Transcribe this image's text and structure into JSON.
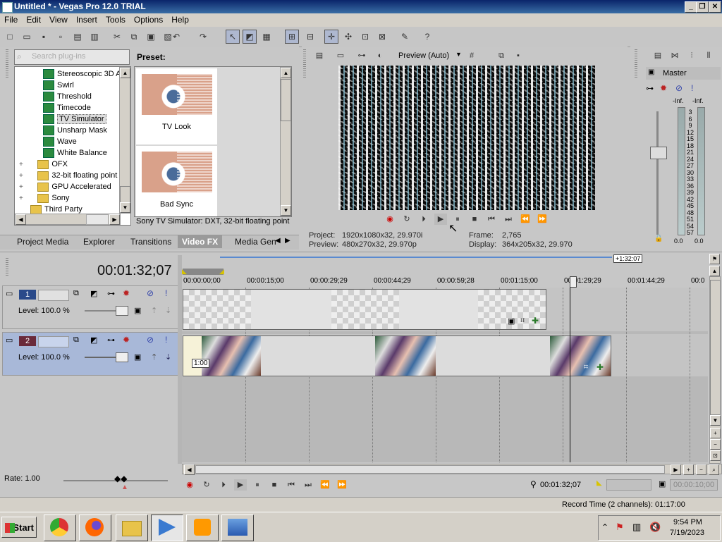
{
  "window": {
    "title": "Untitled * - Vegas Pro 12.0 TRIAL",
    "min": "_",
    "restore": "❐",
    "close": "✕"
  },
  "menu": [
    "File",
    "Edit",
    "View",
    "Insert",
    "Tools",
    "Options",
    "Help"
  ],
  "explorer": {
    "search_placeholder": "Search plug-ins",
    "items": [
      {
        "label": "Stereoscopic 3D A",
        "kind": "fx"
      },
      {
        "label": "Swirl",
        "kind": "fx"
      },
      {
        "label": "Threshold",
        "kind": "fx"
      },
      {
        "label": "Timecode",
        "kind": "fx"
      },
      {
        "label": "TV Simulator",
        "kind": "fx",
        "selected": true
      },
      {
        "label": "Unsharp Mask",
        "kind": "fx"
      },
      {
        "label": "Wave",
        "kind": "fx"
      },
      {
        "label": "White Balance",
        "kind": "fx"
      },
      {
        "label": "OFX",
        "kind": "folder"
      },
      {
        "label": "32-bit floating point",
        "kind": "folder"
      },
      {
        "label": "GPU Accelerated",
        "kind": "folder"
      },
      {
        "label": "Sony",
        "kind": "folder"
      },
      {
        "label": "Third Party",
        "kind": "folder"
      }
    ],
    "preset_label": "Preset:",
    "presets": [
      "TV Look",
      "Bad Sync"
    ],
    "status": "Sony TV Simulator: DXT, 32-bit floating point"
  },
  "tabs": [
    "Project Media",
    "Explorer",
    "Transitions",
    "Video FX",
    "Media Gen"
  ],
  "preview": {
    "mode": "Preview (Auto)",
    "project_label": "Project:",
    "project_value": "1920x1080x32, 29.970i",
    "preview_label": "Preview:",
    "preview_value": "480x270x32, 29.970p",
    "frame_label": "Frame:",
    "frame_value": "2,765",
    "display_label": "Display:",
    "display_value": "364x205x32, 29.970"
  },
  "mixer": {
    "title": "Master",
    "inf_left": "-Inf.",
    "inf_right": "-Inf.",
    "scale": [
      "3",
      "6",
      "9",
      "12",
      "15",
      "18",
      "21",
      "24",
      "27",
      "30",
      "33",
      "36",
      "39",
      "42",
      "45",
      "48",
      "51",
      "54",
      "57"
    ],
    "bottom_left": "0.0",
    "bottom_right": "0.0"
  },
  "timeline": {
    "current_time": "00:01:32;07",
    "end_marker": "+1:32:07",
    "ruler": [
      "00:00:00;00",
      "00:00:15;00",
      "00:00:29;29",
      "00:00:44;29",
      "00:00:59;28",
      "00:01:15;00",
      "00:01:29;29",
      "00:01:44;29",
      "00:0"
    ],
    "tracks": [
      {
        "number": "1",
        "level": "Level: 100.0 %"
      },
      {
        "number": "2",
        "level": "Level: 100.0 %"
      }
    ],
    "clip_rate": "1:00",
    "rate": "Rate: 1.00"
  },
  "transport": {
    "cursor_time": "00:01:32;07",
    "length_time": "00:00:10;00"
  },
  "status_bar": {
    "record_time": "Record Time (2 channels): 01:17:00"
  },
  "taskbar": {
    "start": "Start",
    "time": "9:54 PM",
    "date": "7/19/2023"
  }
}
